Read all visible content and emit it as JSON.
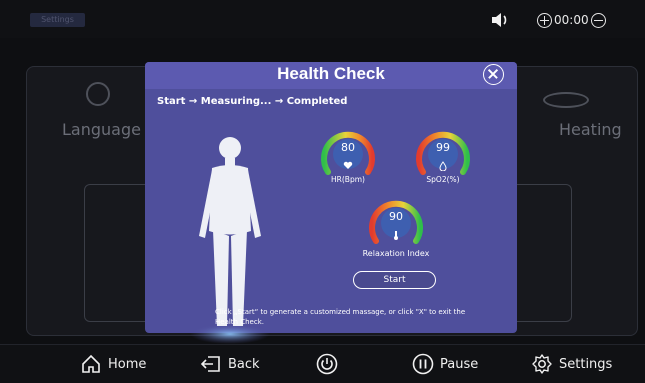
{
  "topbar": {
    "settings_tab": "Settings",
    "timer": "00:00"
  },
  "background": {
    "left_tile_label": "Language",
    "right_tile_label": "Heating"
  },
  "modal": {
    "title": "Health Check",
    "progress": "Start → Measuring... → Completed",
    "gauges": [
      {
        "value": "80",
        "label": "HR(Bpm)"
      },
      {
        "value": "99",
        "label": "SpO2(%)"
      },
      {
        "value": "90",
        "label": "Relaxation Index"
      }
    ],
    "start_button": "Start",
    "instruction": "Click „Start“ to generate a customized massage, or click \"X\" to exit the Health Check."
  },
  "bottombar": {
    "home": "Home",
    "back": "Back",
    "pause": "Pause",
    "settings": "Settings"
  },
  "colors": {
    "modal_bg": "#4f4f9c",
    "modal_header": "#5c5ab0",
    "gauge_inner": "#3e5fb0"
  }
}
